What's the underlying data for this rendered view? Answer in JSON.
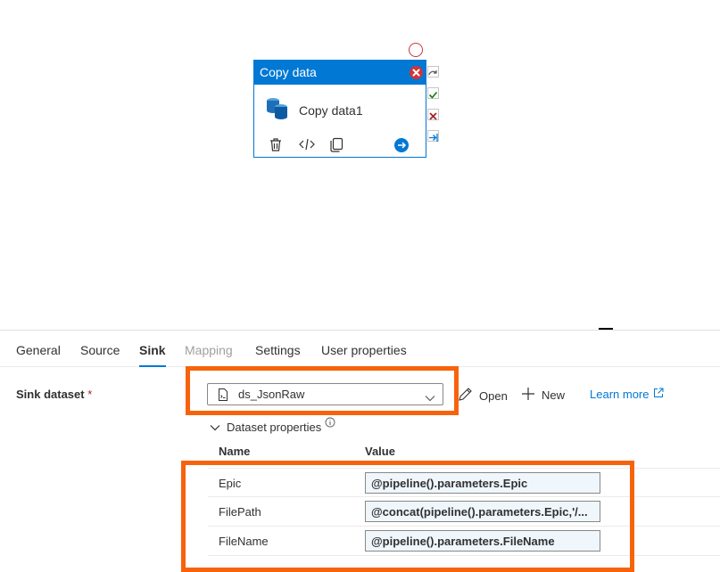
{
  "activity": {
    "header_label": "Copy data",
    "name": "Copy data1"
  },
  "tabs": [
    {
      "label": "General"
    },
    {
      "label": "Source"
    },
    {
      "label": "Sink"
    },
    {
      "label": "Mapping"
    },
    {
      "label": "Settings"
    },
    {
      "label": "User properties"
    }
  ],
  "active_tab": "Sink",
  "sink": {
    "dataset_label": "Sink dataset",
    "required_marker": "*",
    "dataset_value": "ds_JsonRaw",
    "open_label": "Open",
    "new_label": "New",
    "learn_more_label": "Learn more"
  },
  "dataset_properties": {
    "title": "Dataset properties",
    "col_name": "Name",
    "col_value": "Value",
    "rows": [
      {
        "name": "Epic",
        "value": "@pipeline().parameters.Epic"
      },
      {
        "name": "FilePath",
        "value": "@concat(pipeline().parameters.Epic,'/..."
      },
      {
        "name": "FileName",
        "value": "@pipeline().parameters.FileName"
      }
    ]
  },
  "colors": {
    "accent": "#0078d4",
    "highlight": "#f7630c",
    "error": "#d13438",
    "success": "#107c10"
  }
}
